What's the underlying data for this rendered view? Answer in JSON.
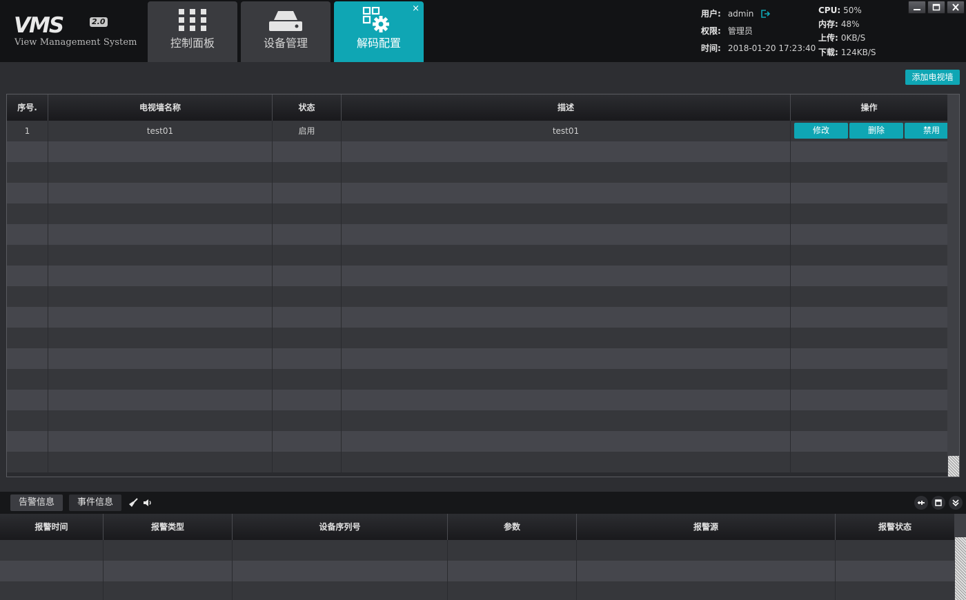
{
  "app": {
    "logo_main": "VMS",
    "logo_version": "2.0",
    "logo_subtitle": "View Management System"
  },
  "tabs": [
    {
      "label": "控制面板",
      "icon": "grid-icon",
      "active": false
    },
    {
      "label": "设备管理",
      "icon": "device-icon",
      "active": false
    },
    {
      "label": "解码配置",
      "icon": "decode-config-icon",
      "active": true,
      "close_label": "×"
    }
  ],
  "user_info": {
    "user_label": "用户:",
    "user_value": "admin",
    "role_label": "权限:",
    "role_value": "管理员",
    "time_label": "时间:",
    "time_value": "2018-01-20 17:23:40"
  },
  "system_stats": {
    "cpu_label": "CPU:",
    "cpu_value": "50%",
    "mem_label": "内存:",
    "mem_value": "48%",
    "upload_label": "上传:",
    "upload_value": "0KB/S",
    "download_label": "下载:",
    "download_value": "124KB/S"
  },
  "window_controls": [
    "minimize-icon",
    "maximize-icon",
    "close-icon"
  ],
  "toolbar": {
    "add_tvwall_label": "添加电视墙"
  },
  "wall_table": {
    "columns": [
      "序号.",
      "电视墙名称",
      "状态",
      "描述",
      "操作"
    ],
    "rows": [
      {
        "index": "1",
        "name": "test01",
        "status": "启用",
        "description": "test01",
        "actions": [
          "修改",
          "删除",
          "禁用"
        ]
      }
    ],
    "empty_row_count": 16
  },
  "bottom_panel": {
    "tabs": [
      {
        "label": "告警信息",
        "active": true
      },
      {
        "label": "事件信息",
        "active": false
      }
    ],
    "tool_icons": [
      "clear-brush-icon",
      "speaker-icon"
    ],
    "right_icons": [
      "pin-icon",
      "restore-panel-icon",
      "collapse-down-icon"
    ],
    "alarm_columns": [
      "报警时间",
      "报警类型",
      "设备序列号",
      "参数",
      "报警源",
      "报警状态"
    ],
    "alarm_empty_rows": 3
  },
  "colors": {
    "accent": "#0fa6b4",
    "background": "#2d2e32",
    "topbar": "#121315",
    "row_odd": "#36373b",
    "row_even": "#45464c"
  }
}
